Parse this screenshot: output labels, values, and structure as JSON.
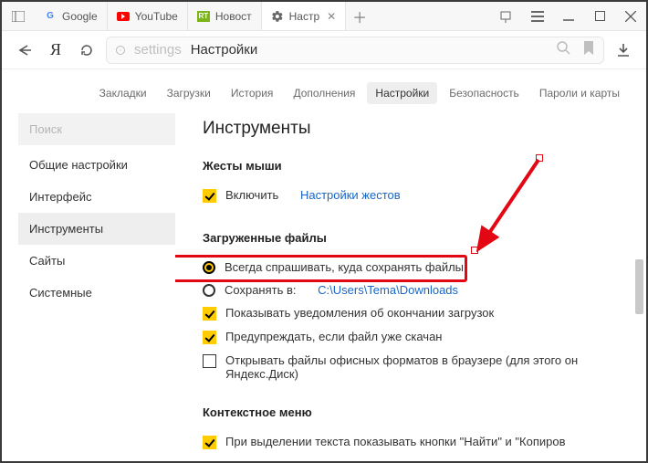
{
  "window": {
    "tabs": [
      {
        "title": "Google",
        "icon": "google"
      },
      {
        "title": "YouTube",
        "icon": "youtube"
      },
      {
        "title": "Новост",
        "icon": "rt"
      },
      {
        "title": "Настр",
        "icon": "gear",
        "active": true
      }
    ]
  },
  "address": {
    "prefix": "settings",
    "text": "Настройки"
  },
  "subtabs": {
    "items": [
      "Закладки",
      "Загрузки",
      "История",
      "Дополнения",
      "Настройки",
      "Безопасность",
      "Пароли и карты"
    ],
    "active": "Настройки"
  },
  "sidebar": {
    "search_placeholder": "Поиск",
    "items": [
      "Общие настройки",
      "Интерфейс",
      "Инструменты",
      "Сайты",
      "Системные"
    ],
    "active": "Инструменты"
  },
  "content": {
    "heading": "Инструменты",
    "mouse": {
      "title": "Жесты мыши",
      "enable": "Включить",
      "link": "Настройки жестов"
    },
    "downloads": {
      "title": "Загруженные файлы",
      "ask": "Всегда спрашивать, куда сохранять файлы",
      "save_in": "Сохранять в:",
      "path": "C:\\Users\\Tema\\Downloads",
      "notify": "Показывать уведомления об окончании загрузок",
      "warn": "Предупреждать, если файл уже скачан",
      "office": "Открывать файлы офисных форматов в браузере (для этого он Яндекс.Диск)"
    },
    "context": {
      "title": "Контекстное меню",
      "item1": "При выделении текста показывать кнопки \"Найти\" и \"Копиров"
    }
  }
}
